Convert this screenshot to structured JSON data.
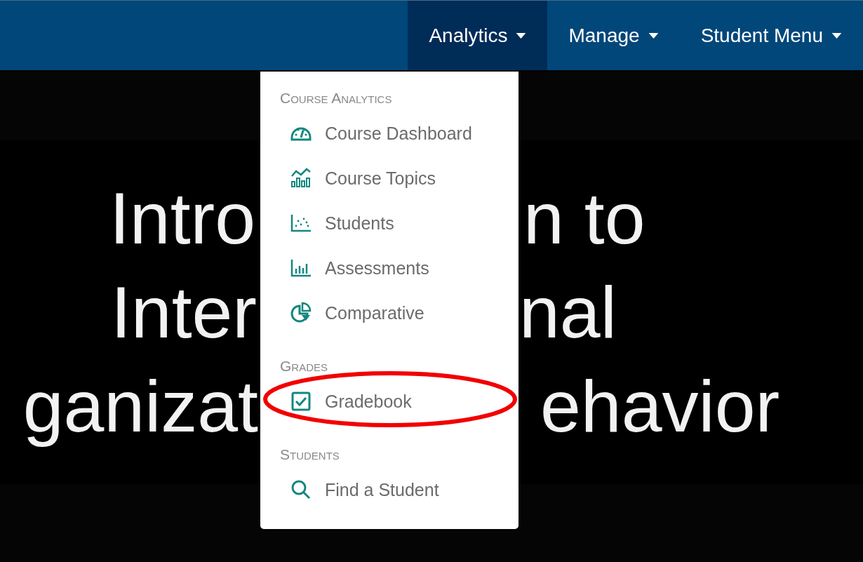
{
  "navbar": {
    "items": [
      {
        "label": "Analytics",
        "selected": true
      },
      {
        "label": "Manage",
        "selected": false
      },
      {
        "label": "Student Menu",
        "selected": false
      }
    ]
  },
  "hero": {
    "title_lines": [
      {
        "left": "Intro",
        "right": "n to"
      },
      {
        "left": "Inter",
        "right": "nal"
      },
      {
        "left": "ganizat",
        "right": "ehavior"
      }
    ]
  },
  "dropdown": {
    "sections": [
      {
        "heading": "Course Analytics",
        "items": [
          {
            "label": "Course Dashboard",
            "kind": "gauge",
            "circled": false
          },
          {
            "label": "Course Topics",
            "kind": "combo",
            "circled": false
          },
          {
            "label": "Students",
            "kind": "scatter",
            "circled": false
          },
          {
            "label": "Assessments",
            "kind": "bars",
            "circled": false
          },
          {
            "label": "Comparative",
            "kind": "pie",
            "circled": false
          }
        ]
      },
      {
        "heading": "Grades",
        "items": [
          {
            "label": "Gradebook",
            "kind": "checkbox",
            "circled": true
          }
        ]
      },
      {
        "heading": "Students",
        "items": [
          {
            "label": "Find a Student",
            "kind": "search",
            "circled": false
          }
        ]
      }
    ]
  }
}
